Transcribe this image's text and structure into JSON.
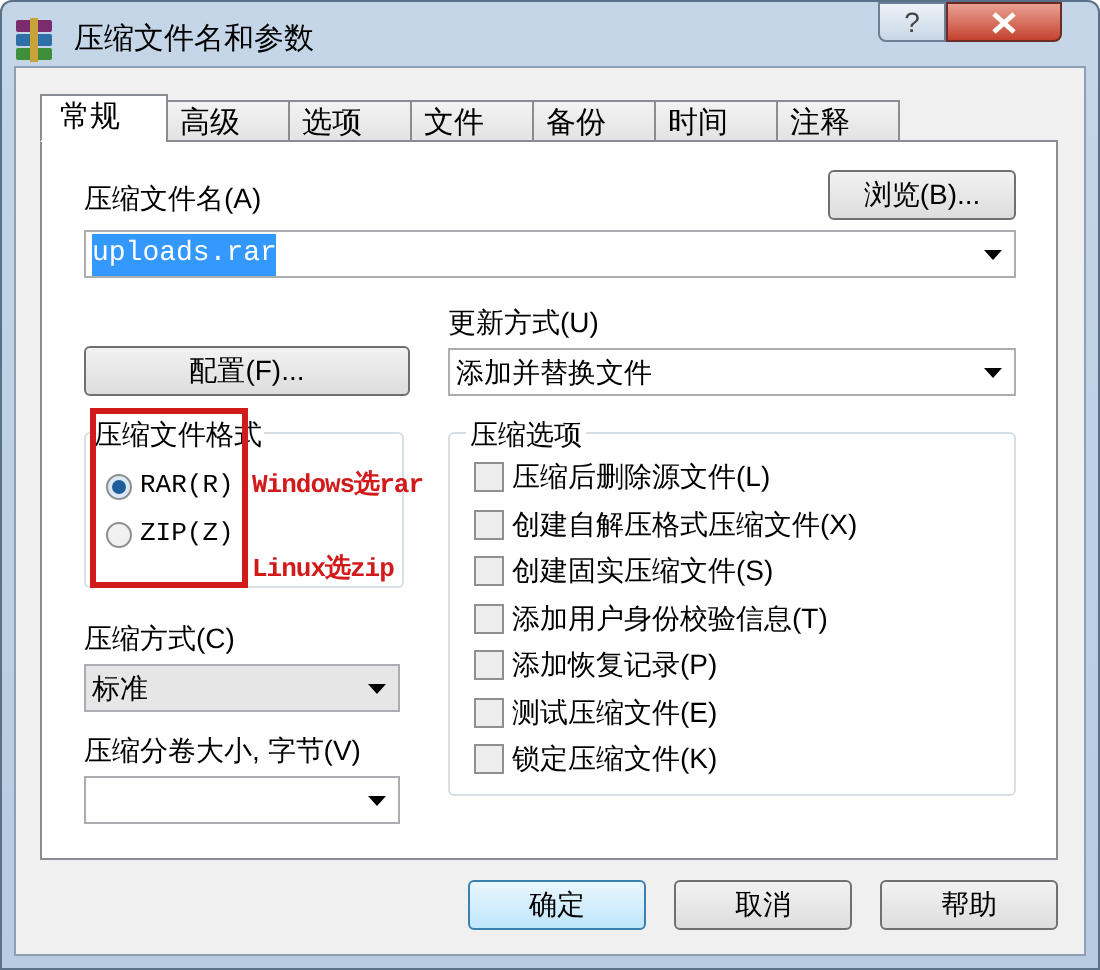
{
  "window": {
    "title": "压缩文件名和参数",
    "help_button": "?"
  },
  "tabs": [
    {
      "label": "常规",
      "selected": true
    },
    {
      "label": "高级",
      "selected": false
    },
    {
      "label": "选项",
      "selected": false
    },
    {
      "label": "文件",
      "selected": false
    },
    {
      "label": "备份",
      "selected": false
    },
    {
      "label": "时间",
      "selected": false
    },
    {
      "label": "注释",
      "selected": false
    }
  ],
  "archive_name": {
    "label": "压缩文件名(A)",
    "value": "uploads.rar",
    "value_selected": true,
    "browse_button": "浏览(B)..."
  },
  "profiles_button": "配置(F)...",
  "update_mode": {
    "label": "更新方式(U)",
    "value": "添加并替换文件"
  },
  "archive_format": {
    "label": "压缩文件格式",
    "options": [
      {
        "label": "RAR(R)",
        "selected": true
      },
      {
        "label": "ZIP(Z)",
        "selected": false
      }
    ]
  },
  "compression_method": {
    "label": "压缩方式(C)",
    "value": "标准"
  },
  "split_size": {
    "label": "压缩分卷大小, 字节(V)"
  },
  "options": {
    "label": "压缩选项",
    "items": [
      {
        "label": "压缩后删除源文件(L)",
        "checked": false
      },
      {
        "label": "创建自解压格式压缩文件(X)",
        "checked": false
      },
      {
        "label": "创建固实压缩文件(S)",
        "checked": false
      },
      {
        "label": "添加用户身份校验信息(T)",
        "checked": false
      },
      {
        "label": "添加恢复记录(P)",
        "checked": false
      },
      {
        "label": "测试压缩文件(E)",
        "checked": false
      },
      {
        "label": "锁定压缩文件(K)",
        "checked": false
      }
    ]
  },
  "buttons": [
    {
      "label": "确定",
      "default": true
    },
    {
      "label": "取消",
      "default": false
    },
    {
      "label": "帮助",
      "default": false
    }
  ],
  "annotations": [
    {
      "text": "Windows选rar"
    },
    {
      "text": "Linux选zip"
    }
  ]
}
